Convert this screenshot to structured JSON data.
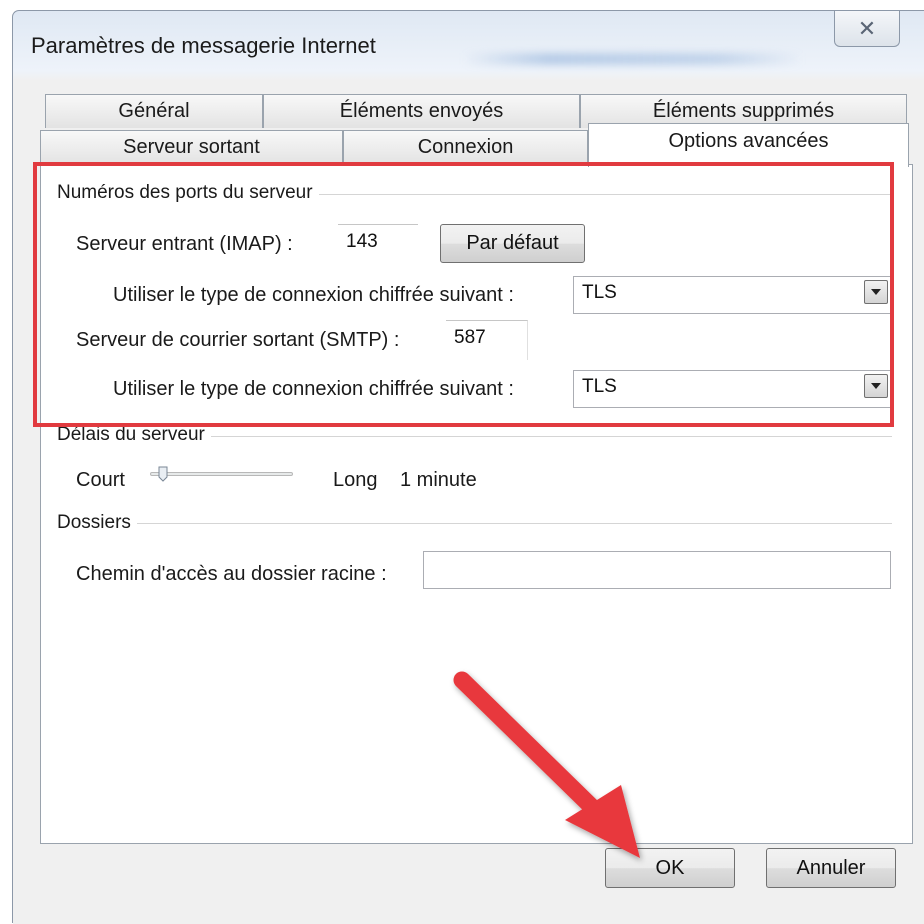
{
  "window": {
    "title": "Paramètres de messagerie Internet",
    "close_glyph": "✕"
  },
  "tabs": {
    "row1": [
      "Général",
      "Éléments envoyés",
      "Éléments supprimés"
    ],
    "row2": [
      "Serveur sortant",
      "Connexion",
      "Options avancées"
    ],
    "active": "Options avancées"
  },
  "ports_group": {
    "title": "Numéros des ports du serveur",
    "incoming_label": "Serveur entrant (IMAP) :",
    "incoming_value": "143",
    "default_button": "Par défaut",
    "encrypt_label_1": "Utiliser le type de connexion chiffrée suivant :",
    "encrypt_value_1": "TLS",
    "outgoing_label": "Serveur de courrier sortant (SMTP) :",
    "outgoing_value": "587",
    "encrypt_label_2": "Utiliser le type de connexion chiffrée suivant :",
    "encrypt_value_2": "TLS"
  },
  "timeout_group": {
    "title": "Délais du serveur",
    "short_label": "Court",
    "long_label": "Long",
    "value": "1 minute",
    "slider_position": 0.05
  },
  "folders_group": {
    "title": "Dossiers",
    "root_path_label": "Chemin d'accès au dossier racine :",
    "root_path_value": ""
  },
  "buttons": {
    "ok": "OK",
    "cancel": "Annuler"
  },
  "colors": {
    "highlight": "#e13a3f",
    "arrow": "#e8383d"
  },
  "icons": {
    "close": "close-icon",
    "dropdown": "chevron-down-icon",
    "annotation": "red-arrow-icon"
  }
}
